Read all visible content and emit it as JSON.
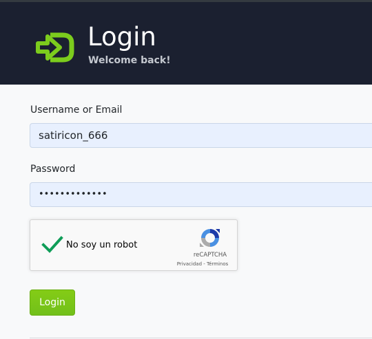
{
  "header": {
    "title": "Login",
    "subtitle": "Welcome back!",
    "icon": "sign-in-icon",
    "background_color": "#1b2030",
    "icon_color": "#7ccc1d"
  },
  "form": {
    "username": {
      "label": "Username or Email",
      "value": "satiricon_666"
    },
    "password": {
      "label": "Password",
      "value": "•••••••••••••"
    },
    "captcha": {
      "label": "No soy un robot",
      "brand": "reCAPTCHA",
      "links": "Privacidad - Términos",
      "checked": true
    },
    "submit_label": "Login",
    "accent_color": "#7ccc1d"
  }
}
